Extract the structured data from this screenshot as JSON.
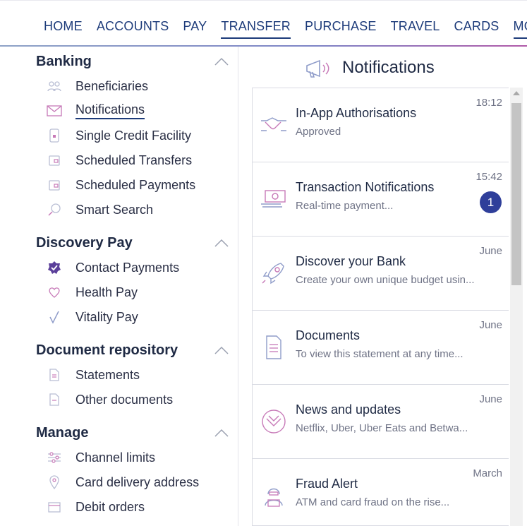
{
  "topnav": {
    "items": [
      "HOME",
      "ACCOUNTS",
      "PAY",
      "TRANSFER",
      "PURCHASE",
      "TRAVEL",
      "CARDS",
      "MORE"
    ]
  },
  "sidebar": {
    "sections": [
      {
        "title": "Banking",
        "items": [
          "Beneficiaries",
          "Notifications",
          "Single Credit Facility",
          "Scheduled Transfers",
          "Scheduled Payments",
          "Smart Search"
        ]
      },
      {
        "title": "Discovery Pay",
        "items": [
          "Contact Payments",
          "Health Pay",
          "Vitality Pay"
        ]
      },
      {
        "title": "Document repository",
        "items": [
          "Statements",
          "Other documents"
        ]
      },
      {
        "title": "Manage",
        "items": [
          "Channel limits",
          "Card delivery address",
          "Debit orders"
        ]
      }
    ]
  },
  "main": {
    "title": "Notifications",
    "notifications": [
      {
        "title": "In-App Authorisations",
        "subtitle": "Approved",
        "time": "18:12",
        "icon": "handshake-icon"
      },
      {
        "title": "Transaction Notifications",
        "subtitle": "Real-time payment...",
        "time": "15:42",
        "badge": "1",
        "icon": "money-icon"
      },
      {
        "title": "Discover your Bank",
        "subtitle": "Create your own unique budget usin...",
        "time": "June",
        "icon": "rocket-icon"
      },
      {
        "title": "Documents",
        "subtitle": "To view this statement at any time...",
        "time": "June",
        "icon": "document-icon"
      },
      {
        "title": "News and updates",
        "subtitle": "Netflix, Uber, Uber Eats and Betwa...",
        "time": "June",
        "icon": "diamond-logo-icon"
      },
      {
        "title": "Fraud Alert",
        "subtitle": "ATM and card fraud on the rise...",
        "time": "March",
        "icon": "hacker-icon"
      }
    ]
  },
  "colors": {
    "accent": "#1d3b7a",
    "badge": "#2f3f9a",
    "icon_pink": "#c77ab8",
    "icon_blue": "#8f9cc9"
  }
}
